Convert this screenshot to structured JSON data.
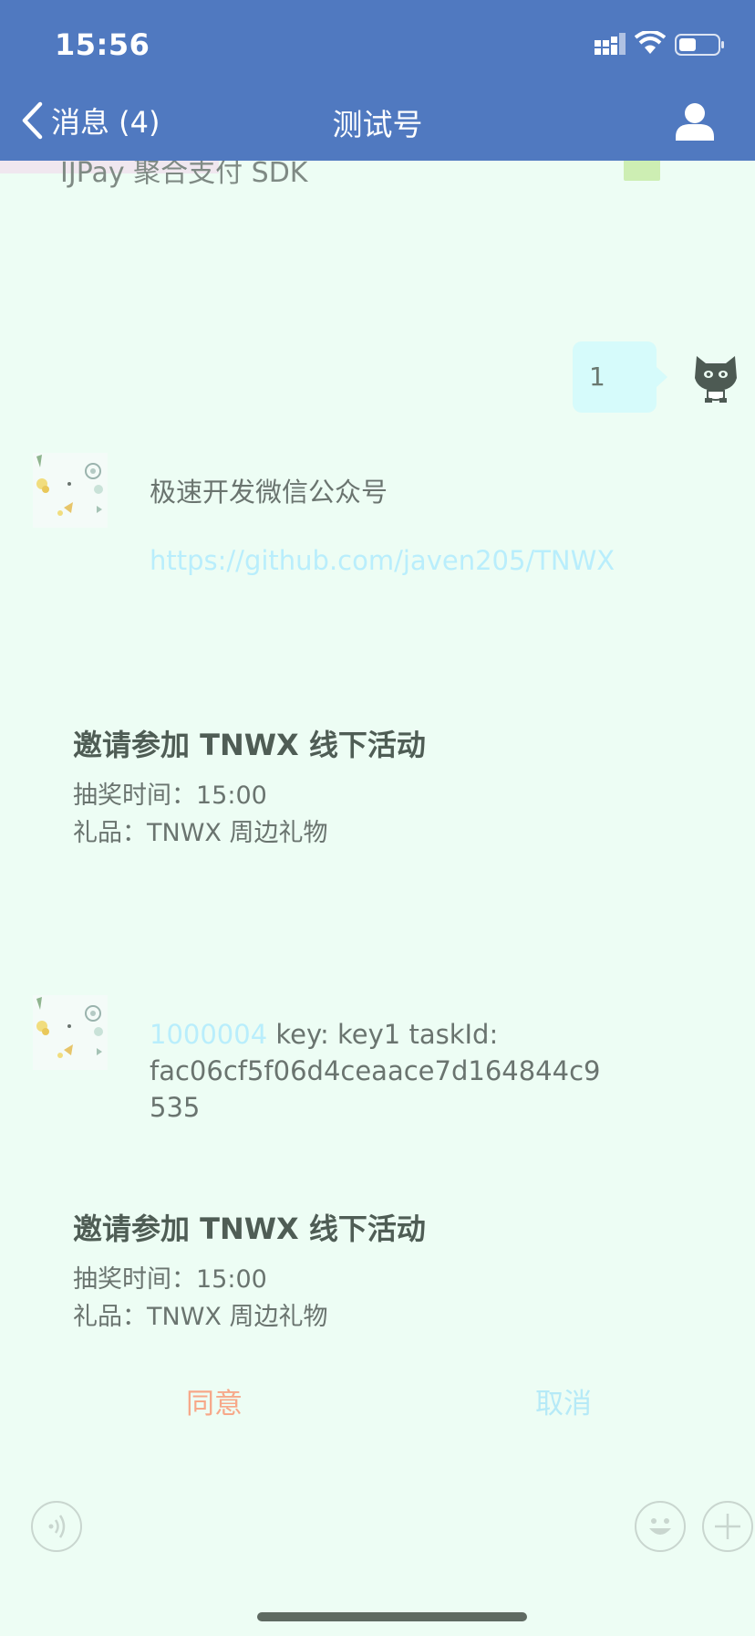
{
  "status_bar": {
    "time": "15:56"
  },
  "nav": {
    "back_label": "消息 (4)",
    "title": "测试号"
  },
  "chat": {
    "previous_message_fragment": "IJPay 聚合支付 SDK",
    "outgoing_message": "1",
    "incoming_1": {
      "text": "极速开发微信公众号",
      "link": "https://github.com/javen205/TNWX"
    },
    "card_1": {
      "title": "邀请参加 TNWX 线下活动",
      "line1": "抽奖时间：15:00",
      "line2": "礼品：TNWX 周边礼物"
    },
    "incoming_2": {
      "link_part": "1000004",
      "text_part": " key: key1 taskId:",
      "line2": "fac06cf5f06d4ceaace7d164844c9",
      "line3": "535"
    },
    "card_2": {
      "title": "邀请参加 TNWX 线下活动",
      "line1": "抽奖时间：15:00",
      "line2": "礼品：TNWX 周边礼物",
      "agree_label": "同意",
      "cancel_label": "取消"
    }
  },
  "icons": {
    "back": "chevron-left-icon",
    "profile": "person-icon",
    "voice": "voice-icon",
    "emoji": "smiley-icon",
    "more": "plus-icon"
  },
  "colors": {
    "header": "#5079c0",
    "background": "#edfdf4",
    "link": "#b9eefc",
    "agree": "#f7a889",
    "cancel": "#b6eaf7"
  }
}
